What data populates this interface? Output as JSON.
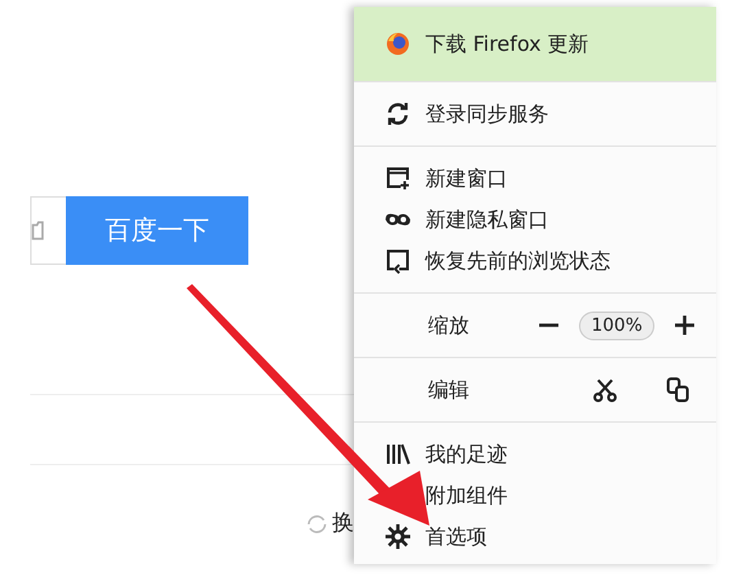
{
  "page": {
    "search_button": "百度一下",
    "refresh_link": "换"
  },
  "menu": {
    "sections": [
      {
        "kind": "update",
        "items": [
          "下载 Firefox 更新"
        ]
      },
      {
        "kind": "list",
        "items": [
          "登录同步服务"
        ]
      },
      {
        "kind": "list",
        "items": [
          "新建窗口",
          "新建隐私窗口",
          "恢复先前的浏览状态"
        ]
      },
      {
        "kind": "zoom",
        "label": "缩放",
        "value": "100%"
      },
      {
        "kind": "edit",
        "label": "编辑"
      },
      {
        "kind": "list",
        "items": [
          "我的足迹",
          "附加组件",
          "首选项"
        ]
      }
    ]
  }
}
